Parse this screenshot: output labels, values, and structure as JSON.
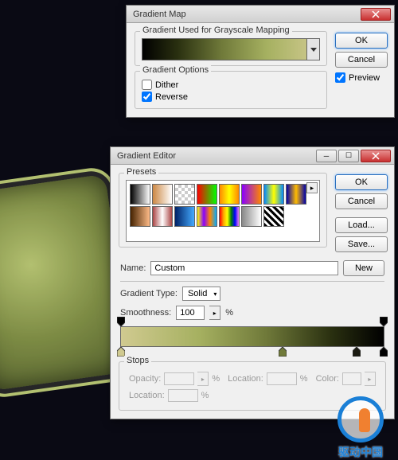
{
  "dlg1": {
    "title": "Gradient Map",
    "group_label": "Gradient Used for Grayscale Mapping",
    "options_label": "Gradient Options",
    "dither": "Dither",
    "reverse": "Reverse",
    "ok": "OK",
    "cancel": "Cancel",
    "preview": "Preview"
  },
  "dlg2": {
    "title": "Gradient Editor",
    "presets_label": "Presets",
    "ok": "OK",
    "cancel": "Cancel",
    "load": "Load...",
    "save": "Save...",
    "name_label": "Name:",
    "name_value": "Custom",
    "new_btn": "New",
    "type_label": "Gradient Type:",
    "type_value": "Solid",
    "smoothness_label": "Smoothness:",
    "smoothness_value": "100",
    "percent": "%",
    "stops_label": "Stops",
    "opacity_label": "Opacity:",
    "location_label": "Location:",
    "color_label": "Color:"
  },
  "watermark": "驱动中国"
}
